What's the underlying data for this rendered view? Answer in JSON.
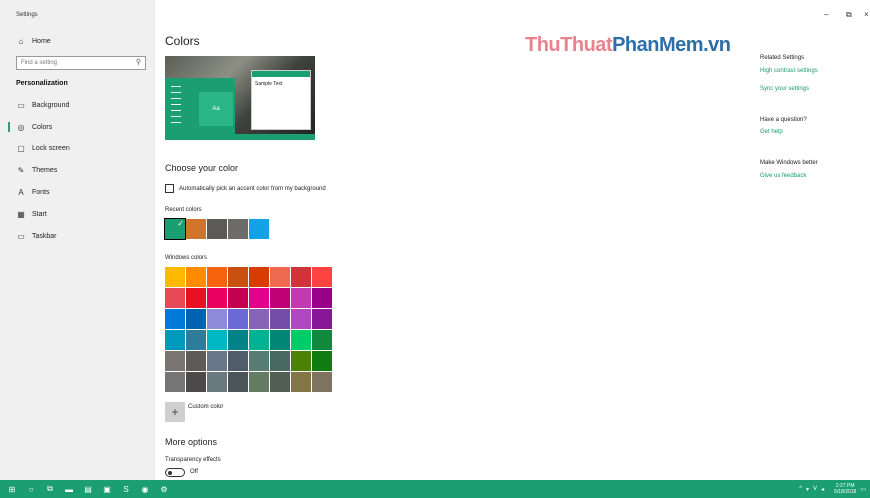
{
  "window": {
    "title": "Settings",
    "minimize": "–",
    "restore": "⧉",
    "close": "×"
  },
  "sidebar": {
    "home_label": "Home",
    "search_placeholder": "Find a setting",
    "section": "Personalization",
    "items": [
      {
        "label": "Background",
        "icon": "image-icon"
      },
      {
        "label": "Colors",
        "icon": "palette-icon",
        "active": true
      },
      {
        "label": "Lock screen",
        "icon": "lock-screen-icon"
      },
      {
        "label": "Themes",
        "icon": "brush-icon"
      },
      {
        "label": "Fonts",
        "icon": "font-icon"
      },
      {
        "label": "Start",
        "icon": "start-icon"
      },
      {
        "label": "Taskbar",
        "icon": "taskbar-icon"
      }
    ]
  },
  "main": {
    "title": "Colors",
    "preview": {
      "sample_text": "Sample Text",
      "tile_text": "Aa"
    },
    "choose_color": "Choose your color",
    "auto_pick_label": "Automatically pick an accent color from my background",
    "recent_colors_label": "Recent colors",
    "recent_colors": [
      "#1c9e73",
      "#d0752a",
      "#5c5a58",
      "#6d6b69",
      "#13a2e3"
    ],
    "windows_colors_label": "Windows colors",
    "windows_colors": [
      [
        "#ffb900",
        "#ff8c00",
        "#f7630c",
        "#ca5010",
        "#da3b01",
        "#ef6950",
        "#d13438",
        "#ff4343"
      ],
      [
        "#e74856",
        "#e81123",
        "#ea005e",
        "#c30052",
        "#e3008c",
        "#bf0077",
        "#c239b3",
        "#9a0089"
      ],
      [
        "#0078d7",
        "#0063b1",
        "#8e8cd8",
        "#6b69d6",
        "#8764b8",
        "#744da9",
        "#b146c2",
        "#881798"
      ],
      [
        "#0099bc",
        "#2d7d9a",
        "#00b7c3",
        "#038387",
        "#00b294",
        "#018574",
        "#00cc6a",
        "#10893e"
      ],
      [
        "#7a7574",
        "#5d5a58",
        "#68768a",
        "#515c6b",
        "#567c73",
        "#486860",
        "#498205",
        "#107c10"
      ],
      [
        "#767676",
        "#4c4a48",
        "#69797e",
        "#4a5459",
        "#647c64",
        "#525e54",
        "#847545",
        "#7e735f"
      ]
    ],
    "custom_color_label": "Custom color",
    "more_options": "More options",
    "transparency_label": "Transparency effects",
    "transparency_state": "Off"
  },
  "related": {
    "heading": "Related Settings",
    "links": [
      "High contrast settings",
      "Sync your settings"
    ],
    "question_heading": "Have a question?",
    "help_link": "Get help",
    "better_heading": "Make Windows better",
    "feedback_link": "Give us feedback"
  },
  "watermark": {
    "part1": "ThuThuat",
    "part2": "PhanMem",
    "part3": ".vn"
  },
  "taskbar": {
    "icons": [
      "windows-start-icon",
      "cortana-icon",
      "task-view-icon",
      "file-explorer-icon",
      "excel-icon",
      "outlook-icon",
      "skype-icon",
      "chrome-icon",
      "settings-gear-icon"
    ],
    "tray_text": [
      "^",
      "V"
    ],
    "time": "2:27 PM",
    "date": "5/18/2018"
  }
}
